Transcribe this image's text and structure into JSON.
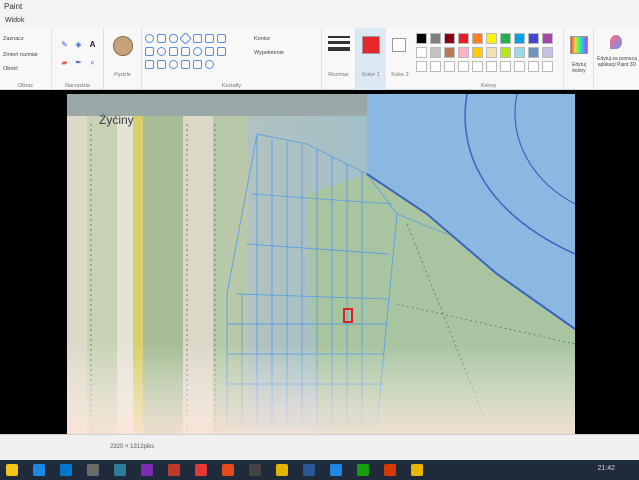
{
  "window": {
    "title": "Paint"
  },
  "menu": {
    "items": [
      "Widok"
    ]
  },
  "ribbon": {
    "groups": {
      "image": {
        "items": [
          "Zaznacz",
          "Zmień rozmiar",
          "Obróć"
        ],
        "label": "Obraz"
      },
      "tools": {
        "label": "Narzędzia",
        "text_icon": "A"
      },
      "brushes": {
        "label": "Pędzle"
      },
      "shapes": {
        "label": "Kształty",
        "outline": "Kontur",
        "fill": "Wypełnienie"
      },
      "size": {
        "label": "Rozmiar"
      },
      "color1": {
        "label": "Kolor 1",
        "value": "#e8262b"
      },
      "color2": {
        "label": "Kolor 2",
        "value": "#ffffff"
      },
      "colors": {
        "label": "Kolory",
        "row1": [
          "#000000",
          "#7f7f7f",
          "#880015",
          "#ed1c24",
          "#ff7f27",
          "#fff200",
          "#22b14c",
          "#00a2e8",
          "#3f48cc",
          "#a349a4"
        ],
        "row2": [
          "#ffffff",
          "#c3c3c3",
          "#b97a57",
          "#ffaec9",
          "#ffc90e",
          "#efe4b0",
          "#b5e61d",
          "#99d9ea",
          "#7092be",
          "#c8bfe7"
        ]
      },
      "edit_colors": {
        "label": "Edytuj kolory"
      },
      "paint3d": {
        "label": "Edytuj za pomocą aplikacji Paint 3D"
      }
    }
  },
  "photo": {
    "label": "Żyćiny"
  },
  "status": {
    "dimensions": "2320 × 1312piks"
  },
  "taskbar": {
    "icons": [
      "#f5c518",
      "#1e88e5",
      "#0078d4",
      "#6b6b6b",
      "#2d7d9a",
      "#7a2fb0",
      "#c0392b",
      "#e53935",
      "#e64a19",
      "#444444",
      "#e4b400",
      "#2b5797",
      "#1e88e5",
      "#13a10e",
      "#d83b01",
      "#e8b600"
    ],
    "time": "21:42"
  }
}
